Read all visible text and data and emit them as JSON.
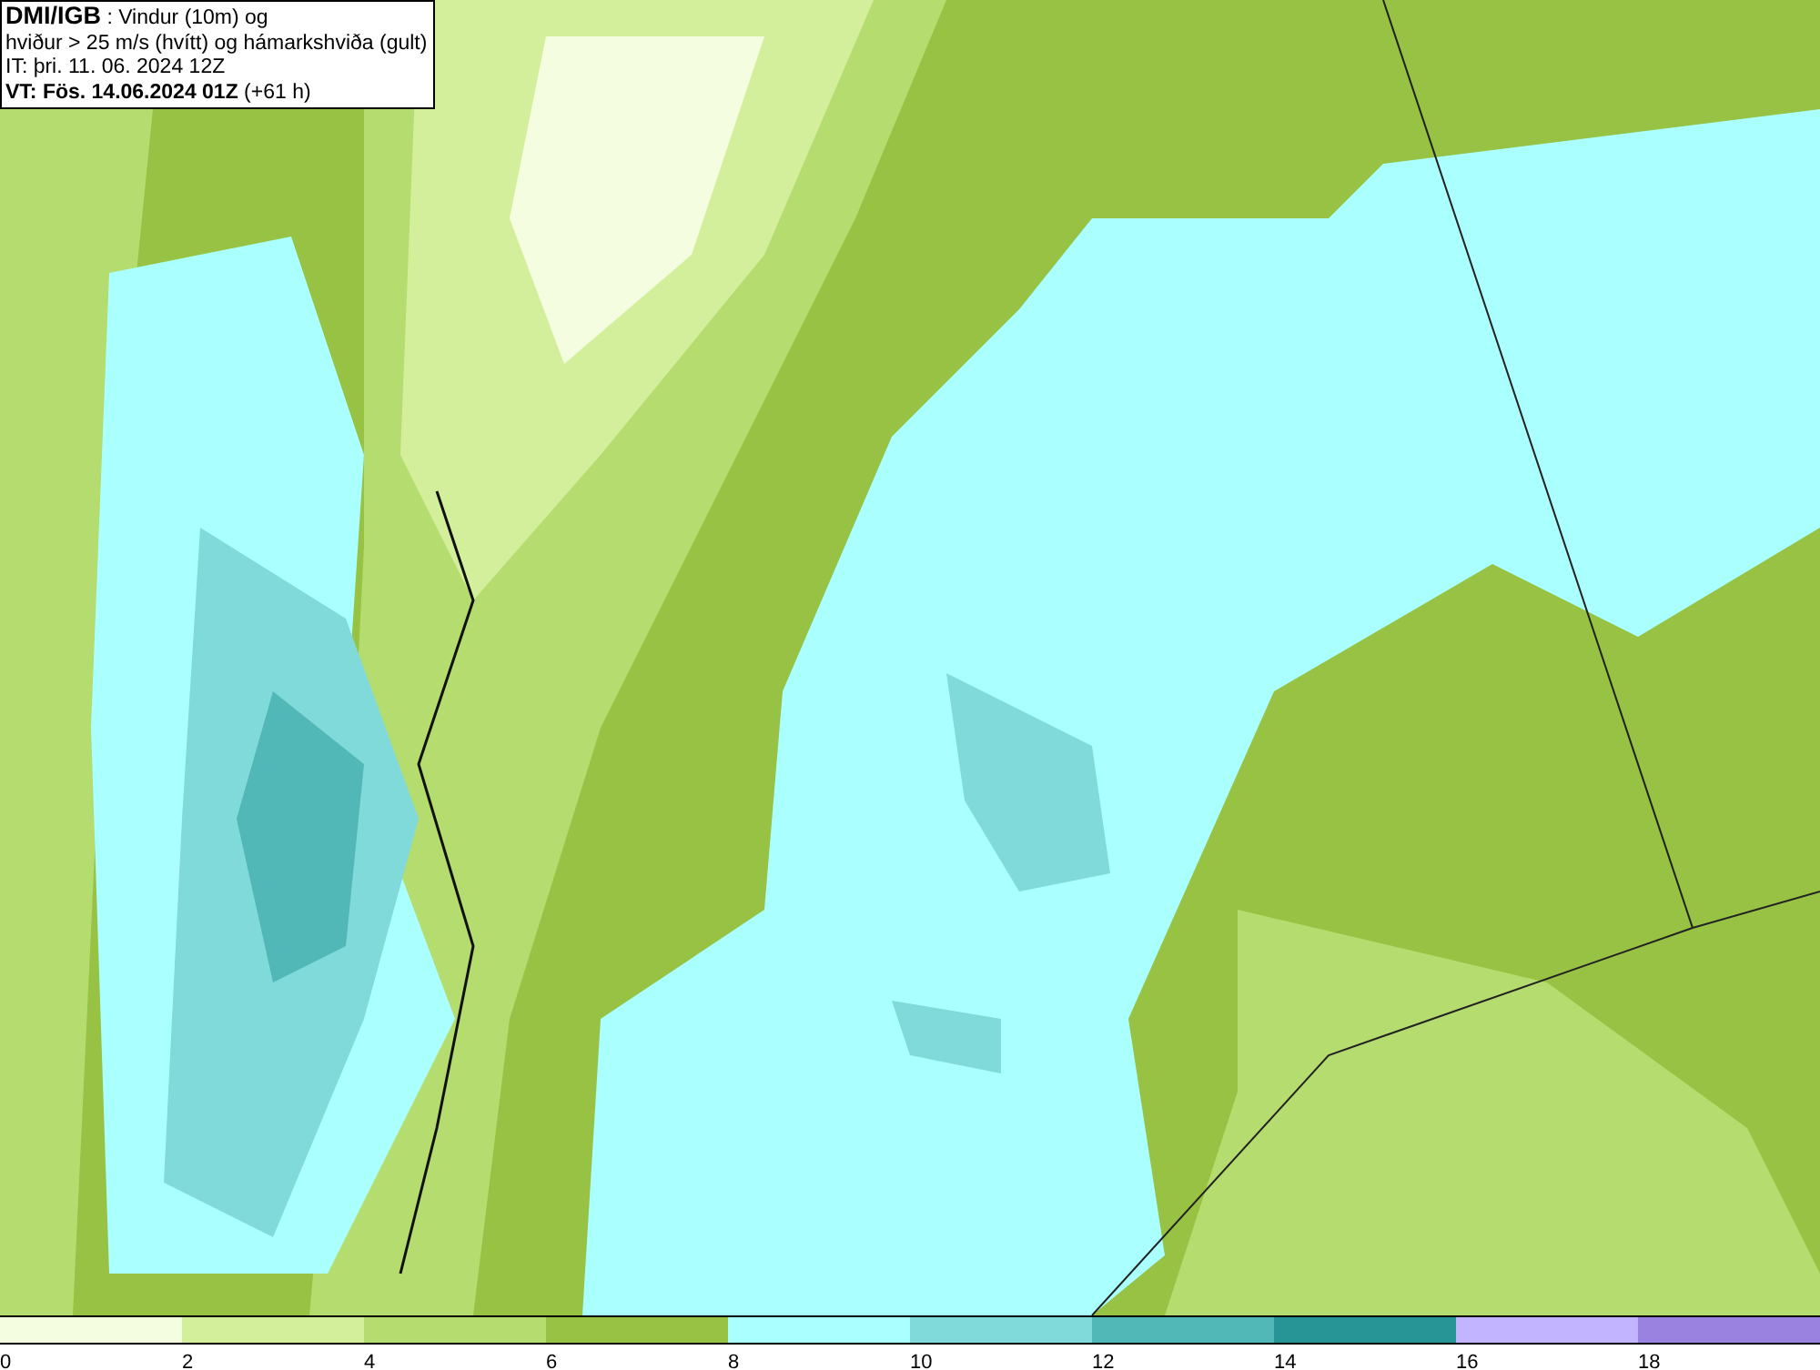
{
  "info_box": {
    "lines": [
      "**DMI/IGB** : Vindur (10m) og",
      "hviður > 25 m/s (hvítt) og hámarkshviða (gult)",
      "IT: þri. 11. 06. 2024 12Z",
      "**VT: Fös. 14.06.2024 01Z** (+61 h)"
    ]
  },
  "legend": {
    "segments": [
      {
        "label": "0",
        "color": "#f5fde0"
      },
      {
        "label": "2",
        "color": "#d4ef9c"
      },
      {
        "label": "4",
        "color": "#b5dc6e"
      },
      {
        "label": "6",
        "color": "#98c244"
      },
      {
        "label": "8",
        "color": "#aaffff"
      },
      {
        "label": "10",
        "color": "#80dada"
      },
      {
        "label": "12",
        "color": "#52b7b7"
      },
      {
        "label": "14",
        "color": "#279595"
      },
      {
        "label": "16",
        "color": "#c2b4ff"
      },
      {
        "label": "18",
        "color": "#9a82e0"
      }
    ]
  }
}
